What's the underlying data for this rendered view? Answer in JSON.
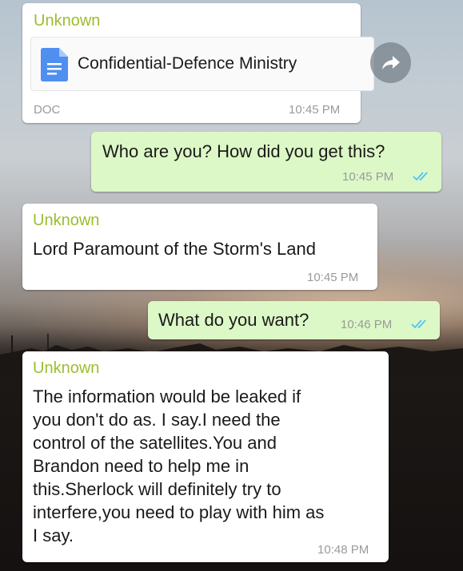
{
  "messages": {
    "doc": {
      "sender": "Unknown",
      "file_name": "Confidential-Defence Ministry",
      "file_type": "DOC",
      "time": "10:45 PM"
    },
    "m1": {
      "text": "Who are you? How did you get this?",
      "time": "10:45 PM"
    },
    "m2": {
      "sender": "Unknown",
      "text": "Lord Paramount of the Storm's Land",
      "time": "10:45 PM"
    },
    "m3": {
      "text": "What do you want?",
      "time": "10:46 PM"
    },
    "m4": {
      "sender": "Unknown",
      "lines": [
        "The information would be leaked if",
        "you don't do as. I say.I need the",
        "control of the satellites.You and",
        "Brandon need to help me in",
        "this.Sherlock will definitely try to",
        "interfere,you need to play with him as",
        "I say."
      ],
      "time": "10:48 PM"
    }
  },
  "colors": {
    "incoming_bubble": "#ffffff",
    "outgoing_bubble": "#dcf8c6",
    "sender_name": "#9dbd2f",
    "read_ticks": "#4fc3f7",
    "doc_icon": "#4f8ff0"
  },
  "icons": {
    "doc": "document-icon",
    "forward": "forward-icon",
    "read": "double-check-icon"
  }
}
